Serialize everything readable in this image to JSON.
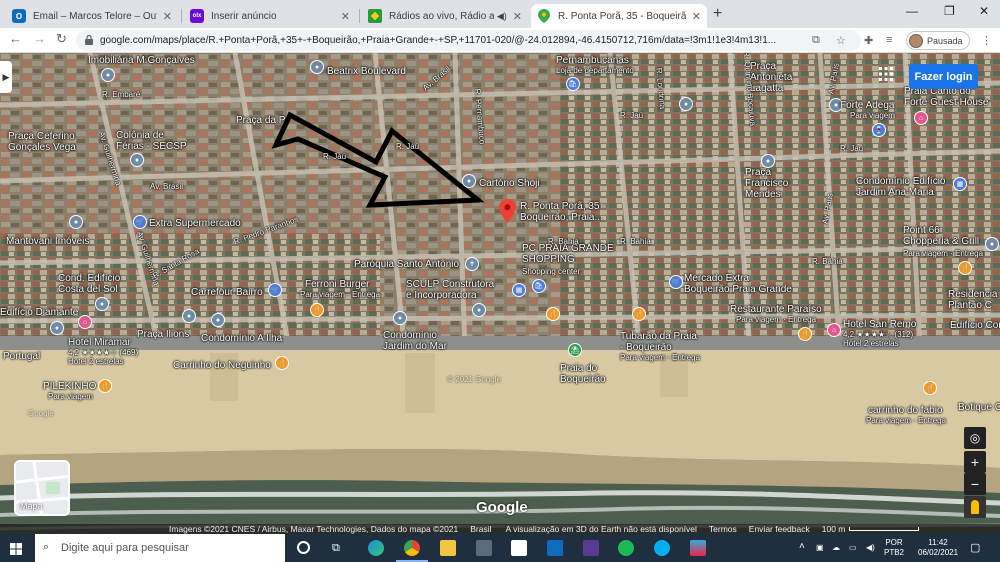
{
  "tabs": [
    {
      "title": "Email – Marcos Telore – Outlook",
      "favicon": "outlook-icon",
      "color": "#0f6cbd",
      "glyph": "O"
    },
    {
      "title": "Inserir anúncio",
      "favicon": "olx-icon",
      "color": "#6e0ad6",
      "glyph": "olx"
    },
    {
      "title": "Rádios ao vivo, Rádio ao vivo",
      "favicon": "radio-brazil-icon",
      "color": "#2a9b3a",
      "glyph": ""
    },
    {
      "title": "R. Ponta Porã, 35 - Boqueirão - G",
      "favicon": "maps-pin-icon",
      "color": "#34a853",
      "glyph": ""
    }
  ],
  "url": "google.com/maps/place/R.+Ponta+Porã,+35+-+Boqueirão,+Praia+Grande+-+SP,+11701-020/@-24.012894,-46.4150712,716m/data=!3m1!1e3!4m13!1...",
  "profile_label": "Pausada",
  "map": {
    "login_label": "Fazer login",
    "thumbnail_label": "Mapa",
    "google_logo": "Google",
    "watermark": "© 2021 Google",
    "watermark2": "Google",
    "address_pin": "R. Ponta Porã, 35 -\nBoqueirão, Praia...",
    "places": [
      {
        "t": "Imobiliária M.Gonçalves"
      },
      {
        "t": "Beatrix Boulevard"
      },
      {
        "t": "Pernambucanas"
      },
      {
        "t": "Loja de departamento"
      },
      {
        "t": "Praça\nAntonieta\nLagatta"
      },
      {
        "t": "Praia Canto do\nForte Guest House"
      },
      {
        "t": "Forte Adega"
      },
      {
        "t": "Para viagem"
      },
      {
        "t": "Praça Ceferino\nGonçales Vega"
      },
      {
        "t": "Colônia de\nFérias - SECSP"
      },
      {
        "t": "Praça da P"
      },
      {
        "t": "Cartório Shoji"
      },
      {
        "t": "Praça\nFrancisco\nMendes"
      },
      {
        "t": "Condomínio Edifício\nJardim Ana Maria"
      },
      {
        "t": "Extra Supermercado"
      },
      {
        "t": "Mantovani Imóveis"
      },
      {
        "t": "PC PRAIA GRANDE\nSHOPPING"
      },
      {
        "t": "Shopping center"
      },
      {
        "t": "Point 66\nChopperia & Grill"
      },
      {
        "t": "Para viagem · Entrega"
      },
      {
        "t": "Paróquia Santo Antônio"
      },
      {
        "t": "Cond. Edifício\nCosta del Sol"
      },
      {
        "t": "Carrefour Bairro"
      },
      {
        "t": "Ferroni Burger"
      },
      {
        "t": "Para viagem · Entrega"
      },
      {
        "t": "SCULP Construtora\ne Incorporadora"
      },
      {
        "t": "Mercado Extra\nBoqueirão Praia Grande"
      },
      {
        "t": "Residencia\nPlantão C"
      },
      {
        "t": "Edifício Diamante"
      },
      {
        "t": "Praça Ilions"
      },
      {
        "t": "Condomínio A Ilha"
      },
      {
        "t": "Restaurante Paraíso"
      },
      {
        "t": "Para viagem · Entrega"
      },
      {
        "t": "Hotel San Remo"
      },
      {
        "t": "4,2 ★★★★☆ (312)\nHotel 2 estrelas"
      },
      {
        "t": "Edifício Con"
      },
      {
        "t": "Hotel Miramar"
      },
      {
        "t": "4,2 ★★★★☆ (469)\nHotel 2 estrelas"
      },
      {
        "t": "Condomínio\nJardim do Mar"
      },
      {
        "t": "Tubarão da Praia\n- Boqueirão"
      },
      {
        "t": "Para viagem · Entrega"
      },
      {
        "t": "Portugal"
      },
      {
        "t": "Carrinho do Neguinho"
      },
      {
        "t": "Praia do\nBoqueirão"
      },
      {
        "t": "PILEKINHO"
      },
      {
        "t": "Para viagem"
      },
      {
        "t": "carrinho do fabio"
      },
      {
        "t": "Para viagem · Entrega"
      },
      {
        "t": "Botique C"
      }
    ],
    "roads": [
      "R. Embaré",
      "Av. Brasil",
      "R. Jaú",
      "R. Jaú",
      "R. Bahia",
      "R. Bahia",
      "R. Bahia",
      "Av. Guilhermina",
      "Av. Guilhermina",
      "R. Pedro Paranhos",
      "Av. Paris",
      "Av. Paris",
      "R. Rio",
      "R. Rio",
      "Av. Brasil",
      "R. Goiás",
      "R. Pernambuco",
      "R. Londrina",
      "R. Quintino Bocaiúva",
      "R. Jaú",
      "R. Jaú",
      "R. Jaú",
      "R. Brasil",
      "R. Pedro Paranhos",
      "R. Ana Costa",
      "R. Santa Rosa"
    ]
  },
  "attribution": {
    "imagery": "Imagens ©2021 CNES / Airbus, Maxar Technologies, Dados do mapa ©2021",
    "country": "Brasil",
    "earth": "A visualização em 3D do Earth não está disponível",
    "terms": "Termos",
    "feedback": "Enviar feedback",
    "scale": "100 m"
  },
  "taskbar": {
    "search_placeholder": "Digite aqui para pesquisar",
    "lang1": "POR",
    "lang2": "PTB2",
    "time": "11:42",
    "date": "06/02/2021"
  }
}
